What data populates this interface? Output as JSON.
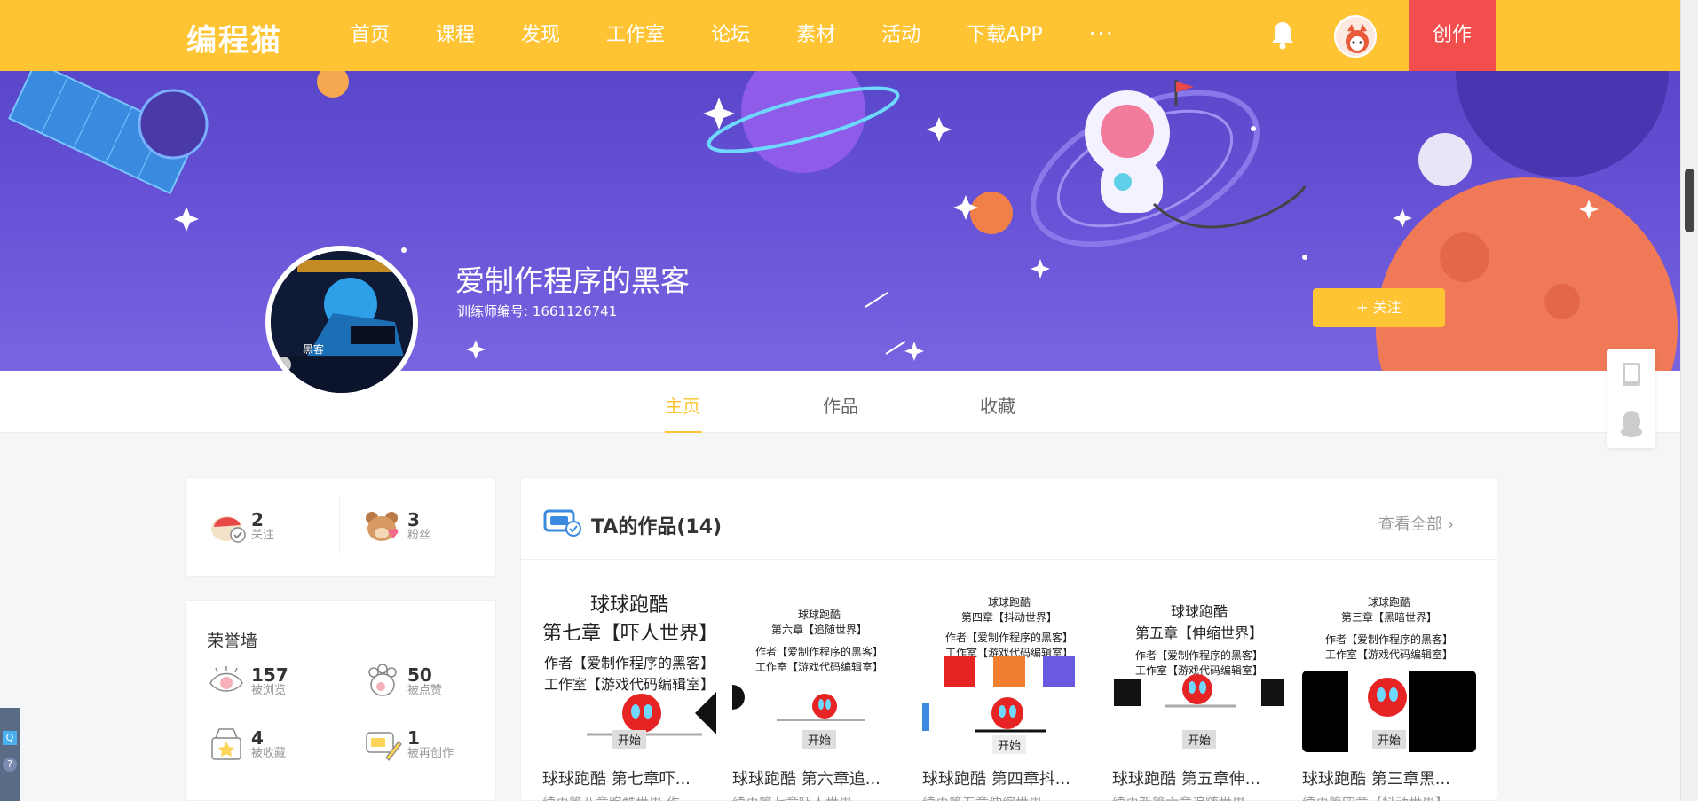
{
  "header": {
    "logo": "编程猫",
    "nav": [
      "首页",
      "课程",
      "发现",
      "工作室",
      "论坛",
      "素材",
      "活动",
      "下载APP"
    ],
    "more": "···",
    "create": "创作"
  },
  "profile": {
    "name": "爱制作程序的黑客",
    "trainer_id": "训练师编号: 1661126741",
    "follow": "+ 关注",
    "avatar_caption": "黑客"
  },
  "tabs": [
    "主页",
    "作品",
    "收藏"
  ],
  "social": {
    "following_num": "2",
    "following_label": "关注",
    "fans_num": "3",
    "fans_label": "粉丝"
  },
  "honor": {
    "title": "荣誉墙",
    "views_num": "157",
    "views_label": "被浏览",
    "likes_num": "50",
    "likes_label": "被点赞",
    "collects_num": "4",
    "collects_label": "被收藏",
    "remix_num": "1",
    "remix_label": "被再创作"
  },
  "works": {
    "title": "TA的作品(14)",
    "view_all": "查看全部",
    "items": [
      {
        "title": "球球跑酷 第七章吓...",
        "sub": "续更第八章跑酷世界 作",
        "t1": "球球跑酷",
        "t2": "第七章【吓人世界】",
        "t3": "作者【爱制作程序的黑客】",
        "t4": "工作室【游戏代码编辑室】",
        "start": "开始"
      },
      {
        "title": "球球跑酷 第六章追...",
        "sub": "续更第七章吓人世界",
        "t1": "球球跑酷",
        "t2": "第六章【追随世界】",
        "t3": "作者【爱制作程序的黑客】",
        "t4": "工作室【游戏代码编辑室】",
        "start": "开始"
      },
      {
        "title": "球球跑酷 第四章抖...",
        "sub": "续更第五章伸缩世界",
        "t1": "球球跑酷",
        "t2": "第四章【抖动世界】",
        "t3": "作者【爱制作程序的黑客】",
        "t4": "工作室【游戏代码编辑室】",
        "start": "开始"
      },
      {
        "title": "球球跑酷 第五章伸...",
        "sub": "续更新第六章追随世界",
        "t1": "球球跑酷",
        "t2": "第五章【伸缩世界】",
        "t3": "作者【爱制作程序的黑客】",
        "t4": "工作室【游戏代码编辑室】",
        "start": "开始"
      },
      {
        "title": "球球跑酷 第三章黑...",
        "sub": "续更第四章【抖动世界】",
        "t1": "球球跑酷",
        "t2": "第三章【黑暗世界】",
        "t3": "作者【爱制作程序的黑客】",
        "t4": "工作室【游戏代码编辑室】",
        "start": "开始"
      }
    ]
  },
  "colors": {
    "accent": "#fec433",
    "create": "#f24e4e",
    "banner": "#5a46c9"
  }
}
